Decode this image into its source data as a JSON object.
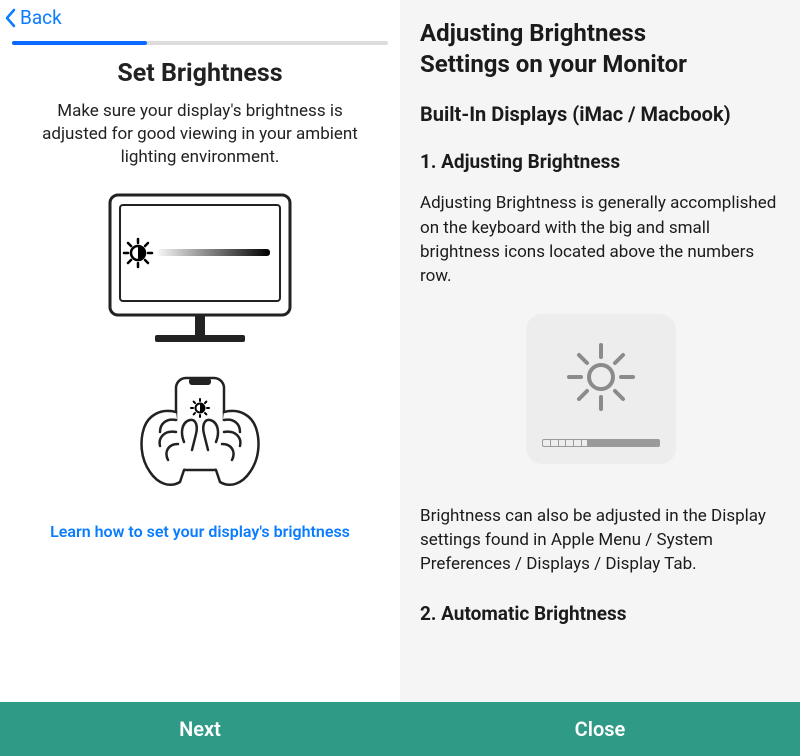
{
  "left": {
    "back_label": "Back",
    "progress_percent": 36,
    "title": "Set Brightness",
    "subtitle": "Make sure your display's brightness is adjusted for good viewing in your ambient lighting environment.",
    "learn_link": "Learn how to set your display's brightness",
    "next_label": "Next"
  },
  "right": {
    "heading_line1": "Adjusting Brightness",
    "heading_line2": "Settings on your Monitor",
    "section_a": "Built-In Displays (iMac / Macbook)",
    "step1_title": "1. Adjusting Brightness",
    "step1_body": "Adjusting Brightness is generally accomplished on the keyboard with the big and small brightness icons located above the numbers row.",
    "step1_body2": "Brightness can also be adjusted in the Display settings found in Apple Menu / System Preferences / Displays / Display Tab.",
    "step2_title": "2. Automatic Brightness",
    "close_label": "Close"
  },
  "colors": {
    "accent": "#0a7cff",
    "button": "#2f9a86"
  }
}
